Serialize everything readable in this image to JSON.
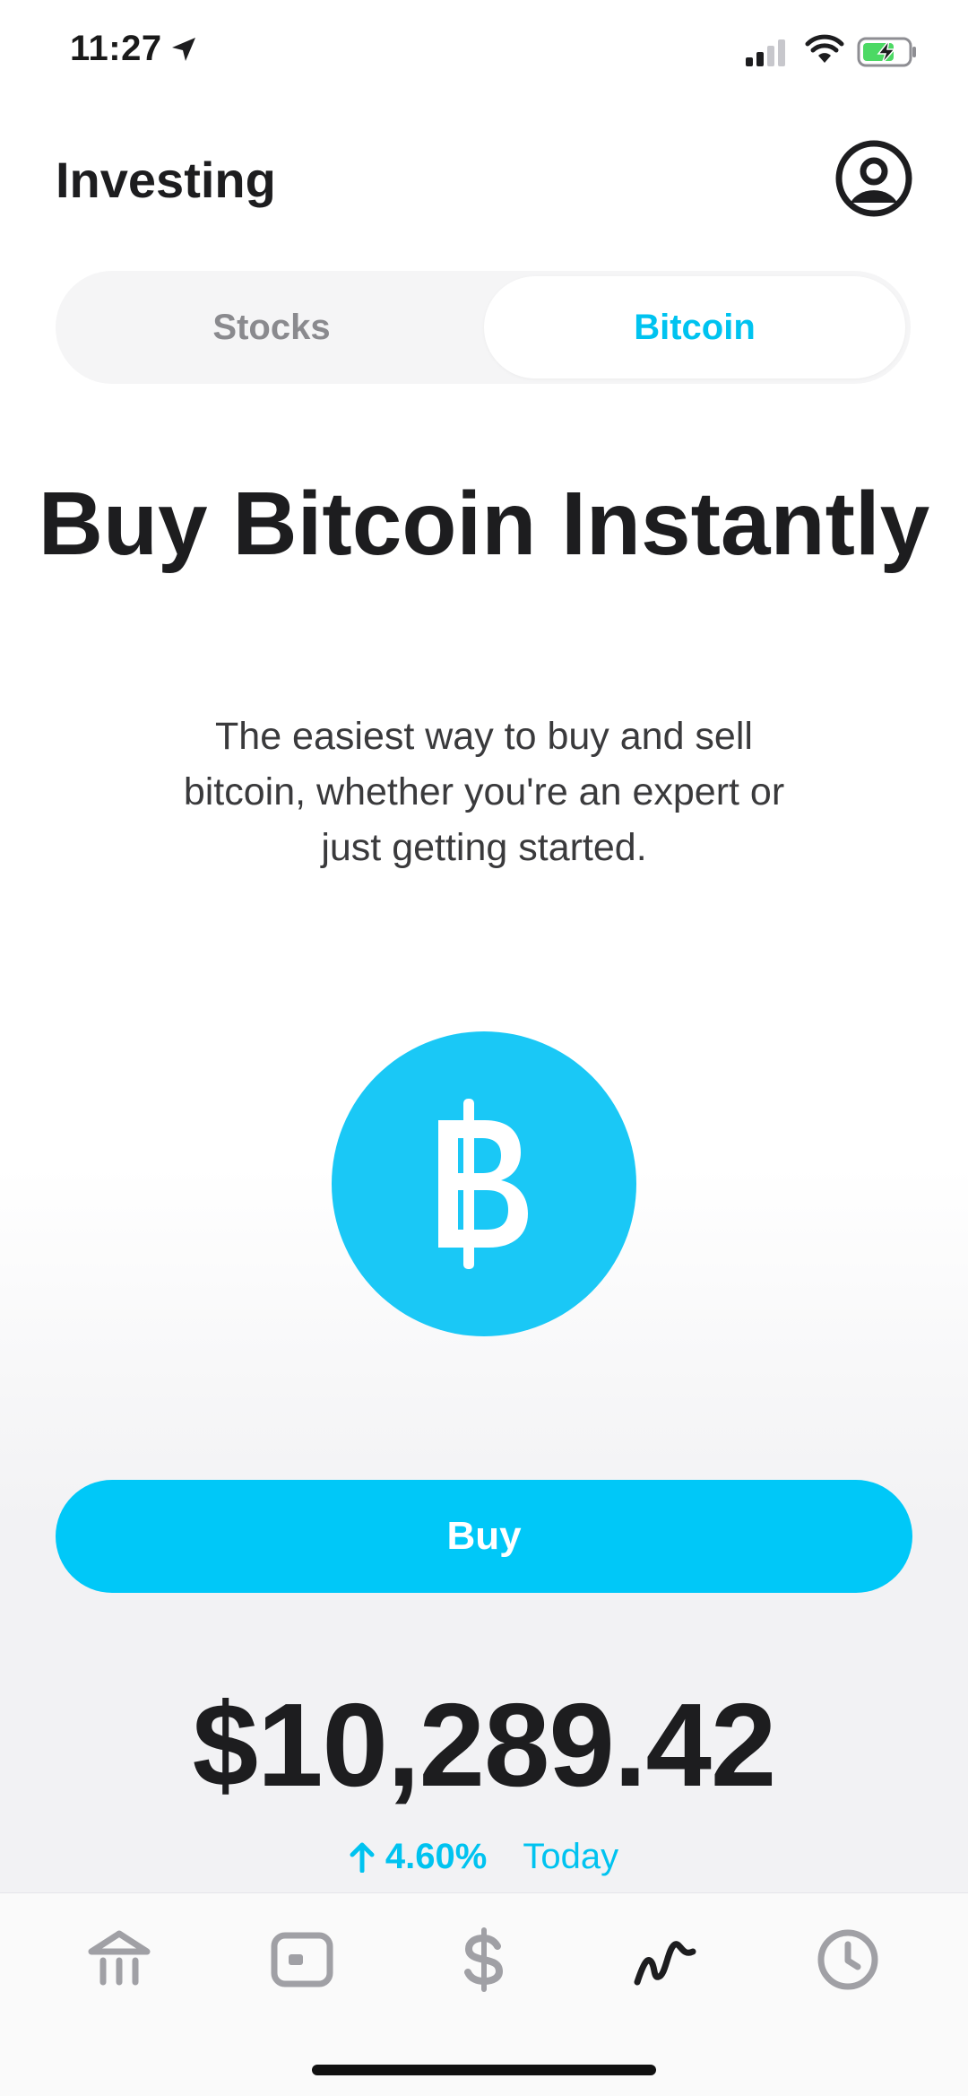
{
  "status_bar": {
    "time": "11:27"
  },
  "header": {
    "title": "Investing"
  },
  "tabs": [
    {
      "label": "Stocks",
      "selected": false
    },
    {
      "label": "Bitcoin",
      "selected": true
    }
  ],
  "hero": {
    "title": "Buy Bitcoin Instantly",
    "description": "The easiest way to buy and sell bitcoin, whether you're an expert or just getting started."
  },
  "buy_button": {
    "label": "Buy"
  },
  "price": {
    "value": "$10,289.42",
    "change": "4.60%",
    "period": "Today",
    "direction": "up"
  },
  "tab_bar": {
    "items": [
      {
        "icon": "bank-icon",
        "selected": false
      },
      {
        "icon": "card-icon",
        "selected": false
      },
      {
        "icon": "dollar-icon",
        "selected": false
      },
      {
        "icon": "investing-icon",
        "selected": true
      },
      {
        "icon": "activity-clock-icon",
        "selected": false
      }
    ]
  },
  "colors": {
    "accent": "#00C3F0",
    "text_primary": "#1D1D1F",
    "text_secondary": "#8A8A8E",
    "tab_inactive": "#A0A0A5",
    "battery_charging": "#4CD964"
  }
}
